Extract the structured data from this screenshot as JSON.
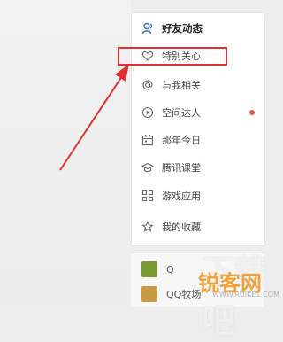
{
  "menu": {
    "header": {
      "label": "好友动态",
      "icon": "friends-icon"
    },
    "items": [
      {
        "label": "特别关心",
        "icon": "heart-outline-icon"
      },
      {
        "label": "与我相关",
        "icon": "at-sign-icon"
      },
      {
        "label": "空间达人",
        "icon": "play-circle-icon",
        "badge": "red-dot"
      },
      {
        "label": "那年今日",
        "icon": "calendar-icon"
      },
      {
        "label": "腾讯课堂",
        "icon": "graduation-cap-icon"
      },
      {
        "label": "游戏应用",
        "icon": "apps-grid-icon"
      },
      {
        "label": "我的收藏",
        "icon": "star-outline-icon"
      }
    ]
  },
  "games": [
    {
      "label": "Q",
      "thumb_color": "#7a9a3a"
    },
    {
      "label": "QQ牧场",
      "thumb_color": "#c89a42"
    }
  ],
  "watermark": {
    "line1": "下载吧",
    "line2": "锐客网",
    "line3": "WWW.RUIKE1.COM"
  },
  "colors": {
    "highlight": "#e03030",
    "badge": "#e05a4f",
    "watermark_orange": "#f1a13a"
  }
}
